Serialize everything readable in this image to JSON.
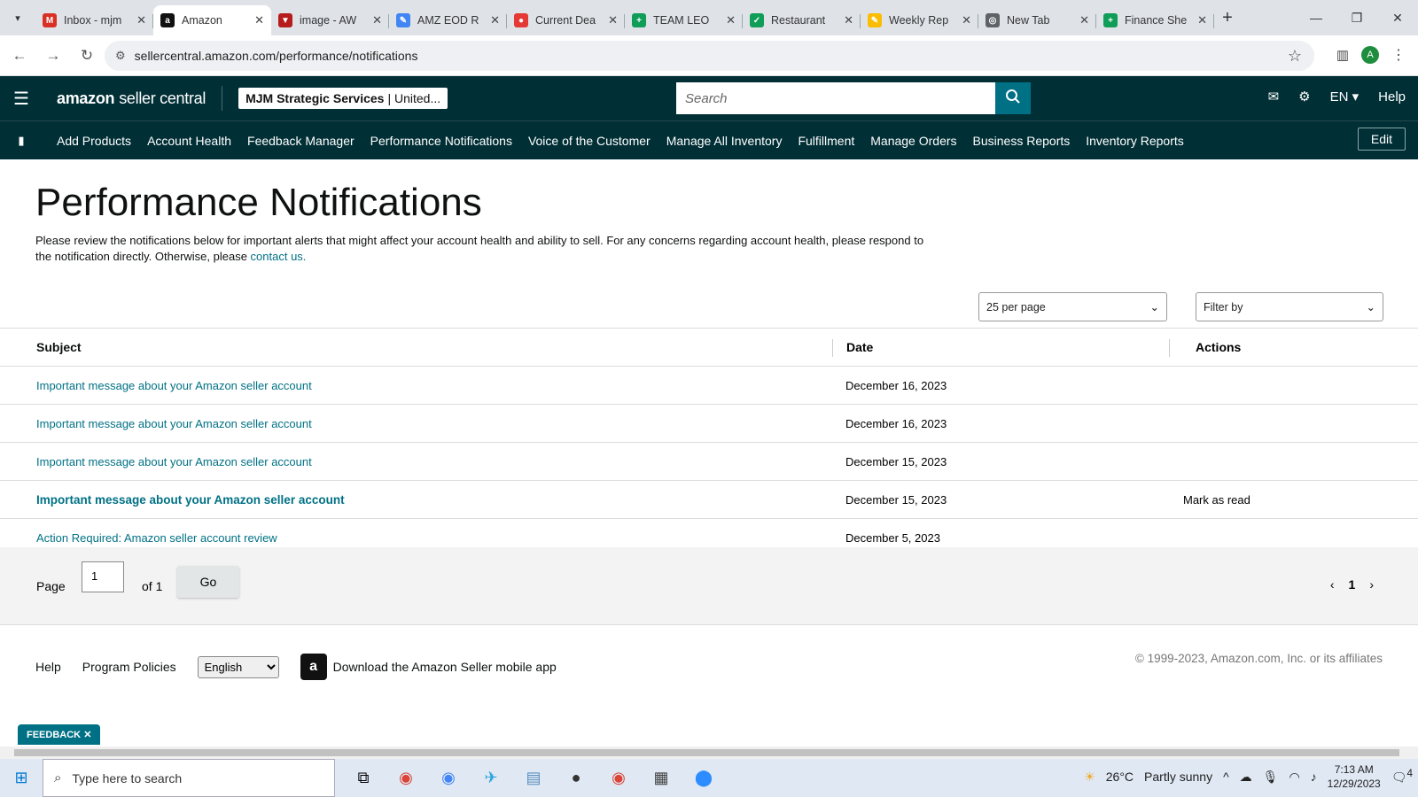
{
  "browser": {
    "tabs": [
      {
        "title": "Inbox - mjm",
        "color": "#d93025",
        "glyph": "M"
      },
      {
        "title": "Amazon",
        "color": "#111111",
        "glyph": "a"
      },
      {
        "title": "image - AW",
        "color": "#b71c1c",
        "glyph": "▼"
      },
      {
        "title": "AMZ EOD R",
        "color": "#4285f4",
        "glyph": "✎"
      },
      {
        "title": "Current Dea",
        "color": "#e53935",
        "glyph": "●"
      },
      {
        "title": "TEAM LEO",
        "color": "#0f9d58",
        "glyph": "+"
      },
      {
        "title": "Restaurant",
        "color": "#0f9d58",
        "glyph": "✓"
      },
      {
        "title": "Weekly Rep",
        "color": "#fbbc04",
        "glyph": "✎"
      },
      {
        "title": "New Tab",
        "color": "#5f6368",
        "glyph": "◎"
      },
      {
        "title": "Finance She",
        "color": "#0f9d58",
        "glyph": "+"
      }
    ],
    "url": "sellercentral.amazon.com/performance/notifications",
    "profile_initial": "A"
  },
  "header": {
    "logo_main": "amazon",
    "logo_sub": "seller central",
    "account_bold": "MJM Strategic Services",
    "account_rest": "| United...",
    "search_placeholder": "Search",
    "lang": "EN",
    "help": "Help"
  },
  "nav": {
    "links": [
      "Add Products",
      "Account Health",
      "Feedback Manager",
      "Performance Notifications",
      "Voice of the Customer",
      "Manage All Inventory",
      "Fulfillment",
      "Manage Orders",
      "Business Reports",
      "Inventory Reports"
    ],
    "edit": "Edit"
  },
  "page": {
    "title": "Performance Notifications",
    "desc": "Please review the notifications below for important alerts that might affect your account health and ability to sell. For any concerns regarding account health, please respond to the notification directly. Otherwise, please ",
    "contact": "contact us.",
    "per_page": "25 per page",
    "filter": "Filter by"
  },
  "table": {
    "headers": {
      "subject": "Subject",
      "date": "Date",
      "actions": "Actions"
    },
    "rows": [
      {
        "subject": "Important message about your Amazon seller account",
        "date": "December 16, 2023",
        "action": "",
        "bold": false
      },
      {
        "subject": "Important message about your Amazon seller account",
        "date": "December 16, 2023",
        "action": "",
        "bold": false
      },
      {
        "subject": "Important message about your Amazon seller account",
        "date": "December 15, 2023",
        "action": "",
        "bold": false
      },
      {
        "subject": "Important message about your Amazon seller account",
        "date": "December 15, 2023",
        "action": "Mark as read",
        "bold": true
      },
      {
        "subject": "Action Required: Amazon seller account review",
        "date": "December 5, 2023",
        "action": "",
        "bold": false
      }
    ]
  },
  "pager": {
    "label": "Page",
    "value": "1",
    "of": "of 1",
    "go": "Go",
    "current": "1"
  },
  "footer": {
    "help": "Help",
    "policies": "Program Policies",
    "language": "English",
    "app": "Download the Amazon Seller mobile app",
    "copyright": "© 1999-2023, Amazon.com, Inc. or its affiliates"
  },
  "feedback": "FEEDBACK",
  "taskbar": {
    "search": "Type here to search",
    "weather_temp": "26°C",
    "weather_desc": "Partly sunny",
    "time": "7:13 AM",
    "date": "12/29/2023",
    "notif_count": "4"
  }
}
